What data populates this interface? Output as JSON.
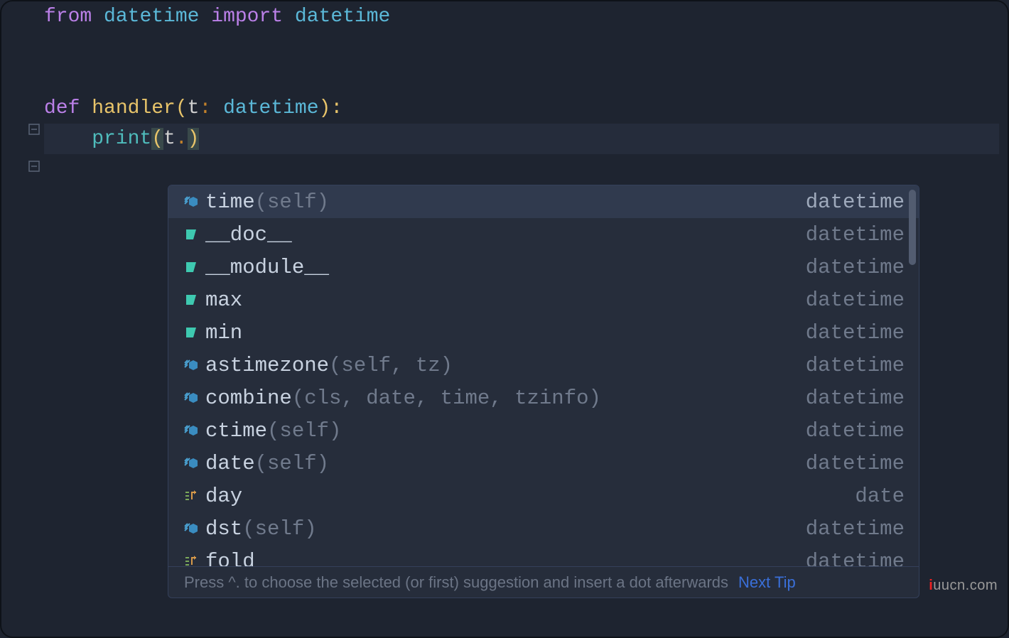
{
  "code": {
    "line1": {
      "kw_from": "from",
      "mod1": "datetime",
      "kw_import": "import",
      "mod2": "datetime"
    },
    "line4": {
      "kw_def": "def",
      "fn": "handler",
      "lp": "(",
      "param": "t",
      "colon": ": ",
      "type": "datetime",
      "rp": "):"
    },
    "line5": {
      "indent": "    ",
      "call": "print",
      "lp": "(",
      "arg": "t",
      "dot": ".",
      "rp": ")"
    }
  },
  "autocomplete": {
    "items": [
      {
        "icon": "method",
        "name": "time",
        "sig": "(self)",
        "type": "datetime",
        "selected": true
      },
      {
        "icon": "field",
        "name": "__doc__",
        "sig": "",
        "type": "datetime"
      },
      {
        "icon": "field",
        "name": "__module__",
        "sig": "",
        "type": "datetime"
      },
      {
        "icon": "field",
        "name": "max",
        "sig": "",
        "type": "datetime"
      },
      {
        "icon": "field",
        "name": "min",
        "sig": "",
        "type": "datetime"
      },
      {
        "icon": "method",
        "name": "astimezone",
        "sig": "(self, tz)",
        "type": "datetime"
      },
      {
        "icon": "method",
        "name": "combine",
        "sig": "(cls, date, time, tzinfo)",
        "type": "datetime"
      },
      {
        "icon": "method",
        "name": "ctime",
        "sig": "(self)",
        "type": "datetime"
      },
      {
        "icon": "method",
        "name": "date",
        "sig": "(self)",
        "type": "datetime"
      },
      {
        "icon": "property",
        "name": "day",
        "sig": "",
        "type": "date"
      },
      {
        "icon": "method",
        "name": "dst",
        "sig": "(self)",
        "type": "datetime"
      },
      {
        "icon": "property",
        "name": "fold",
        "sig": "",
        "type": "datetime"
      }
    ],
    "footer_hint": "Press ^. to choose the selected (or first) suggestion and insert a dot afterwards",
    "footer_link": "Next Tip"
  },
  "watermark": {
    "prefix": "i",
    "rest": "uucn.com"
  }
}
